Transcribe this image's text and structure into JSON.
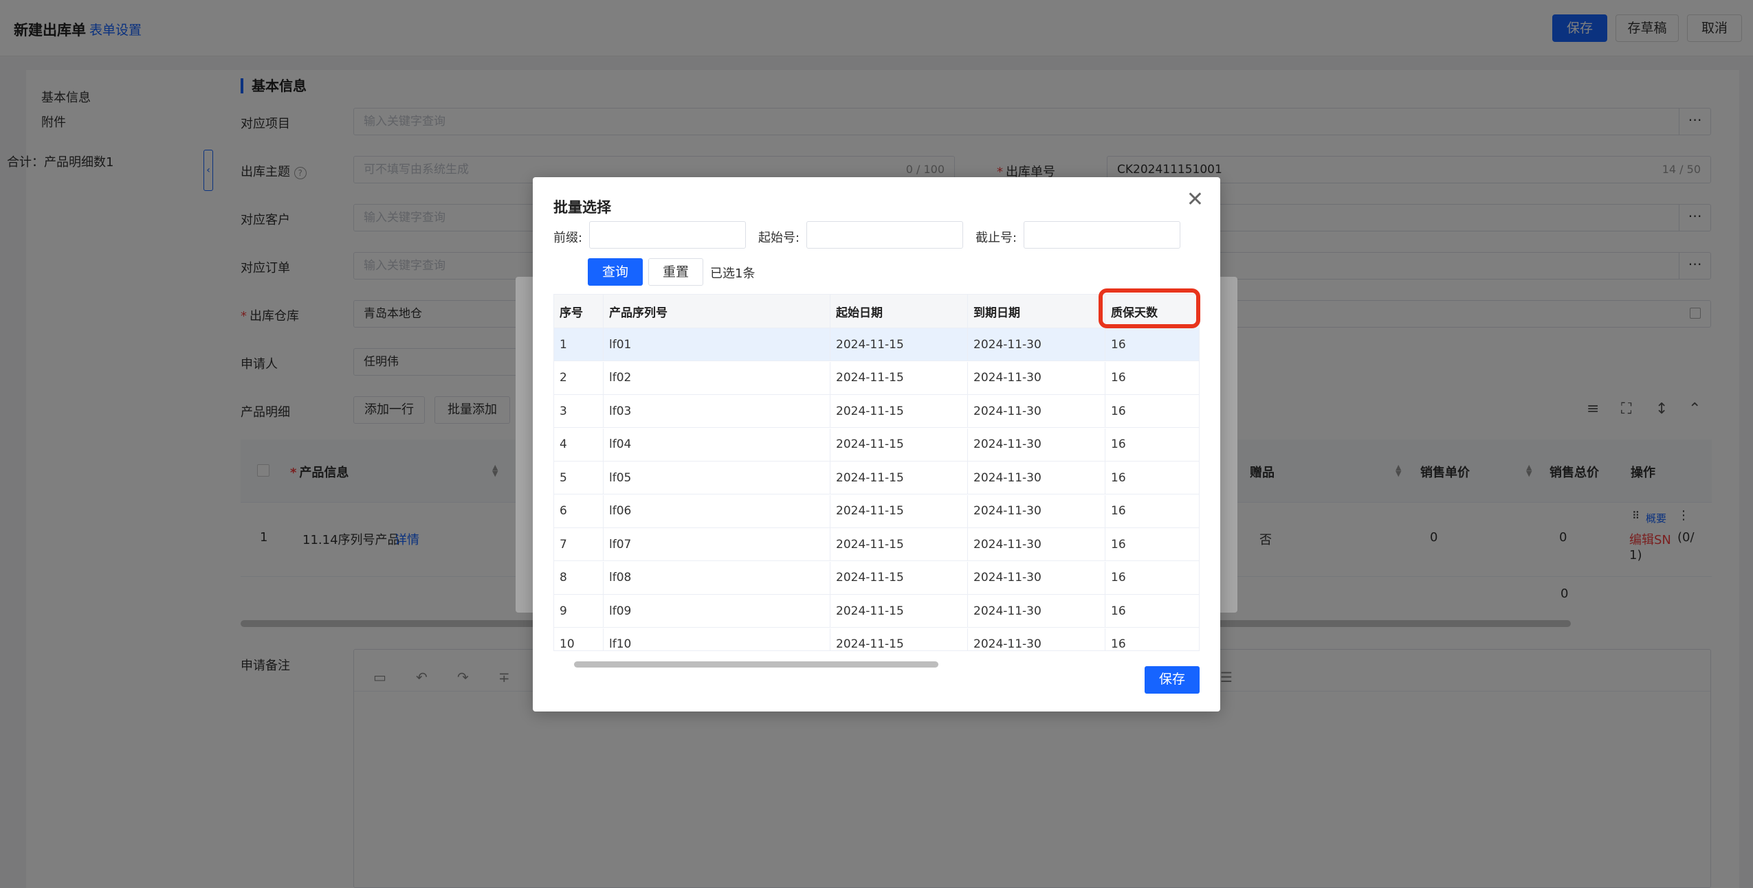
{
  "header": {
    "title": "新建出库单",
    "settings_link": "表单设置",
    "save": "保存",
    "draft": "存草稿",
    "cancel": "取消"
  },
  "sidebar": {
    "items": [
      "基本信息",
      "附件"
    ]
  },
  "section": {
    "title": "基本信息"
  },
  "form": {
    "project_label": "对应项目",
    "project_placeholder": "输入关键字查询",
    "subject_label": "出库主题",
    "subject_placeholder": "可不填写由系统生成",
    "subject_count": "0 / 100",
    "order_no_label": "出库单号",
    "order_no_value": "CK202411151001",
    "order_no_count": "14 / 50",
    "customer_label": "对应客户",
    "customer_placeholder": "输入关键字查询",
    "sales_order_label": "对应订单",
    "sales_order_placeholder": "输入关键字查询",
    "warehouse_label": "出库仓库",
    "warehouse_value": "青岛本地仓",
    "applicant_label": "申请人",
    "applicant_value": "任明伟",
    "detail_label": "产品明细",
    "add_row": "添加一行",
    "batch_add": "批量添加",
    "remark_label": "申请备注",
    "more": "⋯"
  },
  "detail_table": {
    "col_product": "产品信息",
    "col_gift": "赠品",
    "col_unit_price": "销售单价",
    "col_total_price": "销售总价",
    "col_ops": "操作",
    "row": {
      "index": "1",
      "product": "11.14序列号产品",
      "detail_link": "详情",
      "gift": "否",
      "unit_price": "0",
      "total_price": "0",
      "op_overview": "概要",
      "op_edit_sn": "编辑SN",
      "op_sn_count": "(0/",
      "op_sn_count2": "1)"
    },
    "summary": "合计：产品明细数1",
    "summary_total": "0"
  },
  "modal": {
    "title": "批量选择",
    "prefix_label": "前缀:",
    "start_label": "起始号:",
    "end_label": "截止号:",
    "query": "查询",
    "reset": "重置",
    "selected": "已选1条",
    "headers": [
      "序号",
      "产品序列号",
      "起始日期",
      "到期日期",
      "质保天数"
    ],
    "rows": [
      [
        "1",
        "lf01",
        "2024-11-15",
        "2024-11-30",
        "16"
      ],
      [
        "2",
        "lf02",
        "2024-11-15",
        "2024-11-30",
        "16"
      ],
      [
        "3",
        "lf03",
        "2024-11-15",
        "2024-11-30",
        "16"
      ],
      [
        "4",
        "lf04",
        "2024-11-15",
        "2024-11-30",
        "16"
      ],
      [
        "5",
        "lf05",
        "2024-11-15",
        "2024-11-30",
        "16"
      ],
      [
        "6",
        "lf06",
        "2024-11-15",
        "2024-11-30",
        "16"
      ],
      [
        "7",
        "lf07",
        "2024-11-15",
        "2024-11-30",
        "16"
      ],
      [
        "8",
        "lf08",
        "2024-11-15",
        "2024-11-30",
        "16"
      ],
      [
        "9",
        "lf09",
        "2024-11-15",
        "2024-11-30",
        "16"
      ],
      [
        "10",
        "lf10",
        "2024-11-15",
        "2024-11-30",
        "16"
      ]
    ],
    "save": "保存",
    "close_icon": "close-icon"
  },
  "colors": {
    "primary": "#1664ff",
    "highlight": "#e8341c",
    "selected_row": "#e8f1fd"
  }
}
